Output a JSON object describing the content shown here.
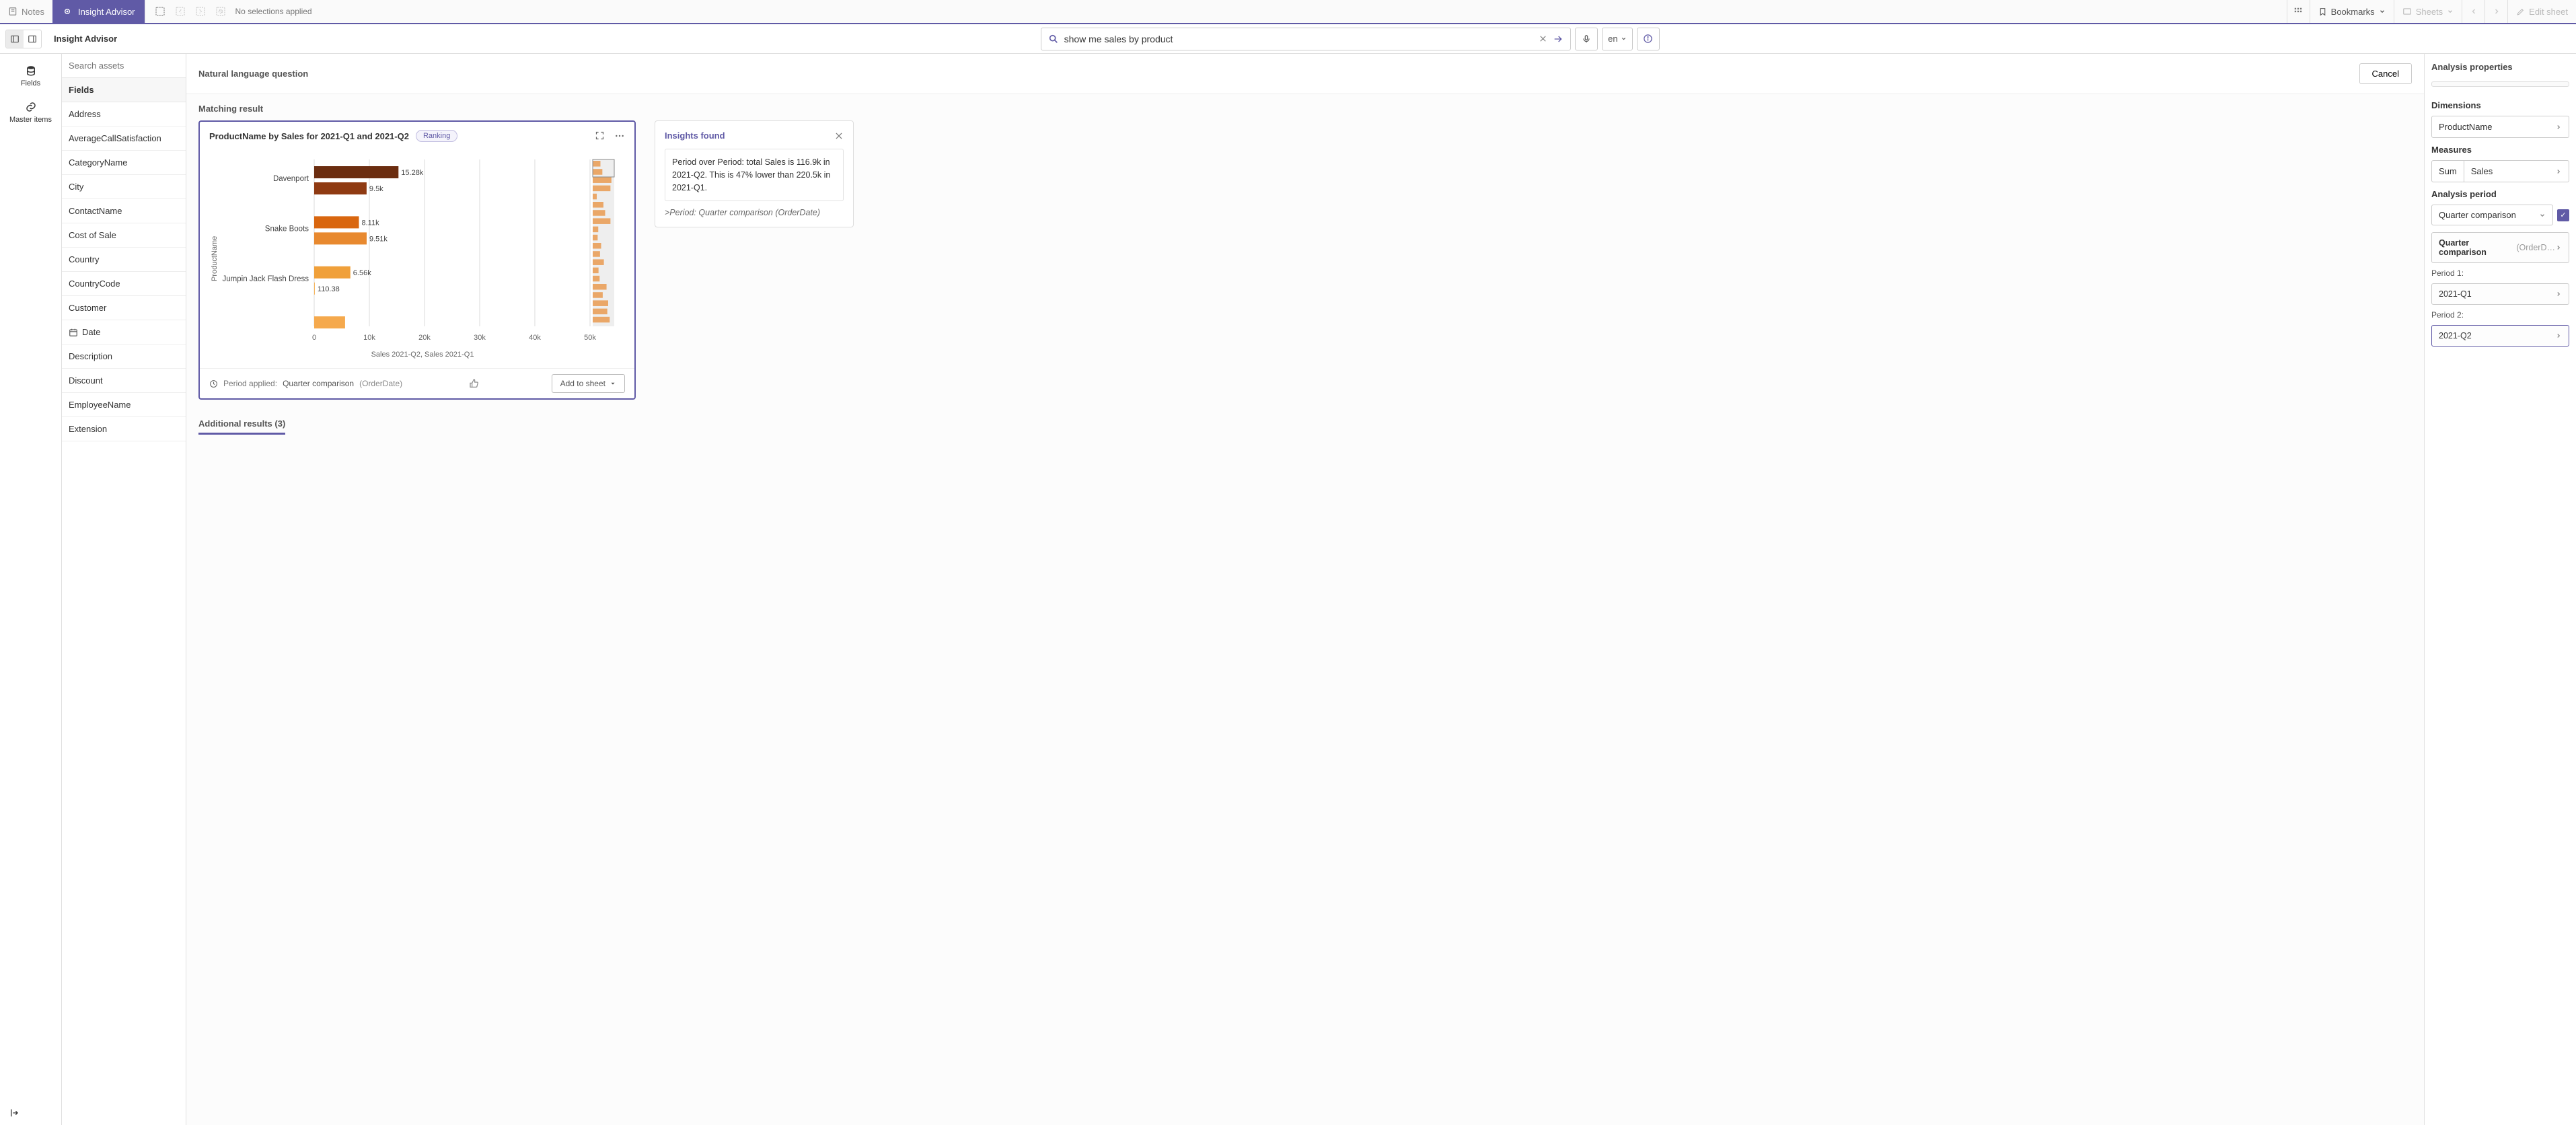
{
  "toolbar": {
    "notes": "Notes",
    "insight_advisor": "Insight Advisor",
    "no_selections": "No selections applied",
    "bookmarks": "Bookmarks",
    "sheets": "Sheets",
    "edit_sheet": "Edit sheet"
  },
  "second_bar": {
    "title": "Insight Advisor",
    "search_prefix": "show me ",
    "search_bold1": "sales",
    "search_mid": " by ",
    "search_bold2": "product",
    "search_value": "show me sales by product",
    "lang": "en"
  },
  "left_rail": {
    "fields": "Fields",
    "master_items": "Master items"
  },
  "fields_panel": {
    "search_placeholder": "Search assets",
    "header": "Fields",
    "items": [
      "Address",
      "AverageCallSatisfaction",
      "CategoryName",
      "City",
      "ContactName",
      "Cost of Sale",
      "Country",
      "CountryCode",
      "Customer",
      "Date",
      "Description",
      "Discount",
      "EmployeeName",
      "Extension"
    ],
    "date_index": 9
  },
  "center": {
    "nlq": "Natural language question",
    "cancel": "Cancel",
    "matching": "Matching result",
    "card_title": "ProductName by Sales for 2021-Q1 and 2021-Q2",
    "badge": "Ranking",
    "y_axis": "ProductName",
    "x_axis": "Sales 2021-Q2, Sales 2021-Q1",
    "period_applied_label": "Period applied:",
    "period_applied_value": "Quarter comparison",
    "period_applied_paren": "(OrderDate)",
    "add_to_sheet": "Add to sheet",
    "additional": "Additional results (3)"
  },
  "insights": {
    "title": "Insights found",
    "body": "Period over Period: total Sales is 116.9k in 2021-Q2. This is 47% lower than 220.5k in 2021-Q1.",
    "sub": ">Period: Quarter comparison (OrderDate)"
  },
  "props": {
    "title": "Analysis properties",
    "dimensions": "Dimensions",
    "dim1": "ProductName",
    "measures": "Measures",
    "agg": "Sum",
    "measure1": "Sales",
    "analysis_period": "Analysis period",
    "comparison": "Quarter comparison",
    "comparison_detail_bold": "Quarter comparison",
    "comparison_detail_grey": " (OrderD…",
    "period1_label": "Period 1:",
    "period1_value": "2021-Q1",
    "period2_label": "Period 2:",
    "period2_value": "2021-Q2"
  },
  "chart_data": {
    "type": "bar",
    "orientation": "horizontal",
    "title": "ProductName by Sales for 2021-Q1 and 2021-Q2",
    "ylabel": "ProductName",
    "xlabel": "Sales 2021-Q2, Sales 2021-Q1",
    "xlim": [
      0,
      50000
    ],
    "xticks": [
      0,
      10000,
      20000,
      30000,
      40000,
      50000
    ],
    "xtick_labels": [
      "0",
      "10k",
      "20k",
      "30k",
      "40k",
      "50k"
    ],
    "categories": [
      "Davenport",
      "Snake Boots",
      "Jumpin Jack Flash Dress"
    ],
    "series": [
      {
        "name": "Sales 2021-Q2",
        "values": [
          15280,
          8110,
          6560
        ],
        "labels": [
          "15.28k",
          "8.11k",
          "6.56k"
        ],
        "color": "#6b2d10"
      },
      {
        "name": "Sales 2021-Q1",
        "values": [
          9500,
          9510,
          110.38
        ],
        "labels": [
          "9.5k",
          "9.51k",
          "110.38"
        ],
        "color": "#e8892f"
      }
    ],
    "extra_bar": {
      "color": "#f5a94d",
      "value": 5600
    }
  }
}
